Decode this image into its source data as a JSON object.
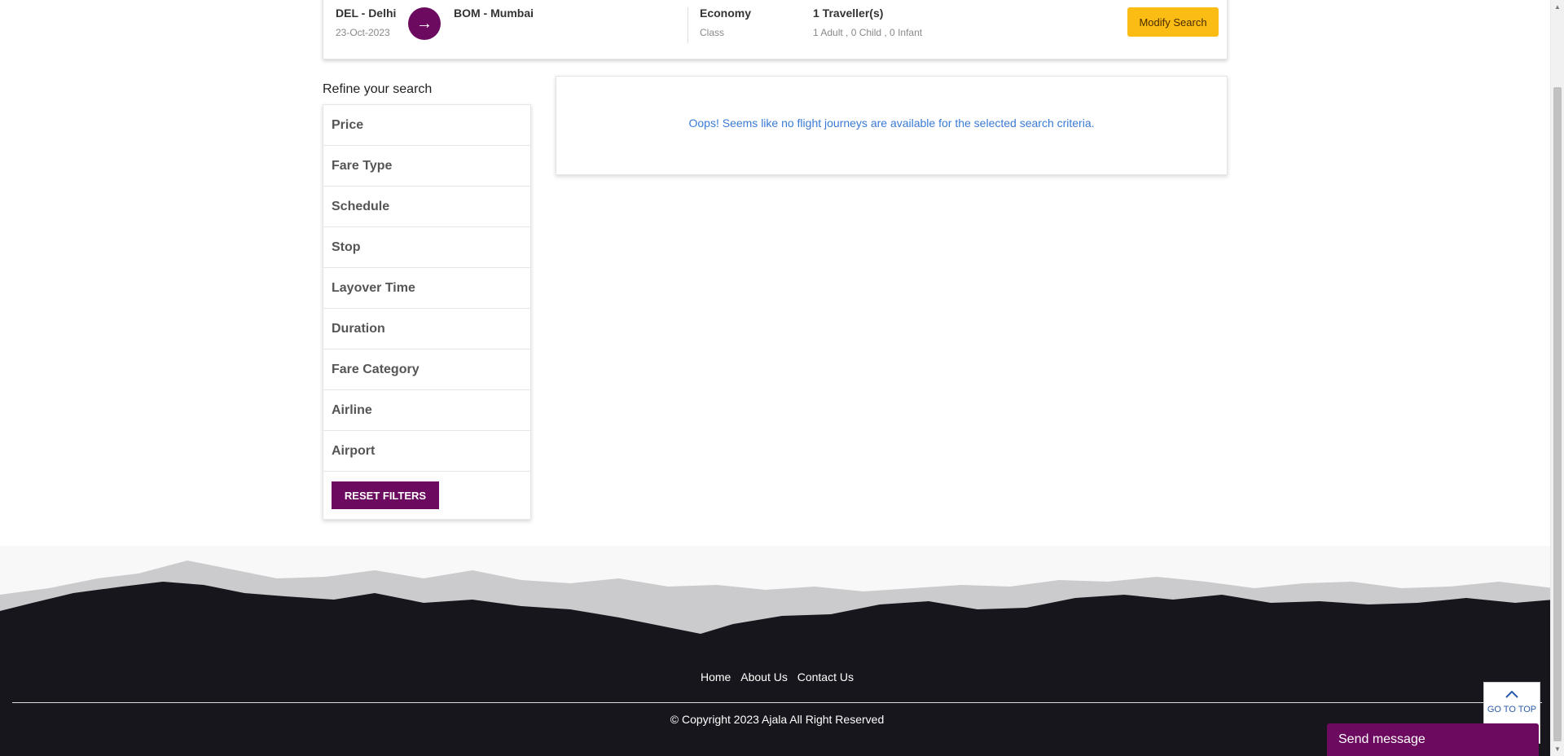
{
  "search_summary": {
    "origin_code": "DEL - Delhi",
    "origin_date": "23-Oct-2023",
    "destination_code": "BOM - Mumbai",
    "class_label": "Economy",
    "class_sub": "Class",
    "travellers_label": "1 Traveller(s)",
    "travellers_sub": "1 Adult , 0 Child , 0 Infant",
    "modify_button": "Modify Search",
    "arrow_icon": "→"
  },
  "refine": {
    "title": "Refine your search",
    "filters": [
      "Price",
      "Fare Type",
      "Schedule",
      "Stop",
      "Layover Time",
      "Duration",
      "Fare Category",
      "Airline",
      "Airport"
    ],
    "reset_button": "RESET FILTERS"
  },
  "results": {
    "message": "Oops! Seems like no flight journeys are available for the selected search criteria."
  },
  "footer": {
    "links": [
      "Home",
      "About Us",
      "Contact Us"
    ],
    "copyright": "© Copyright 2023 Ajala All Right Reserved"
  },
  "go_top": {
    "label": "GO TO TOP",
    "icon": "chevron-up-icon"
  },
  "chat": {
    "label": "Send message"
  },
  "colors": {
    "brand_purple": "#6b0a5e",
    "accent_yellow": "#fbbc13",
    "footer_dark": "#16161c",
    "link_blue": "#3a7bd5"
  }
}
